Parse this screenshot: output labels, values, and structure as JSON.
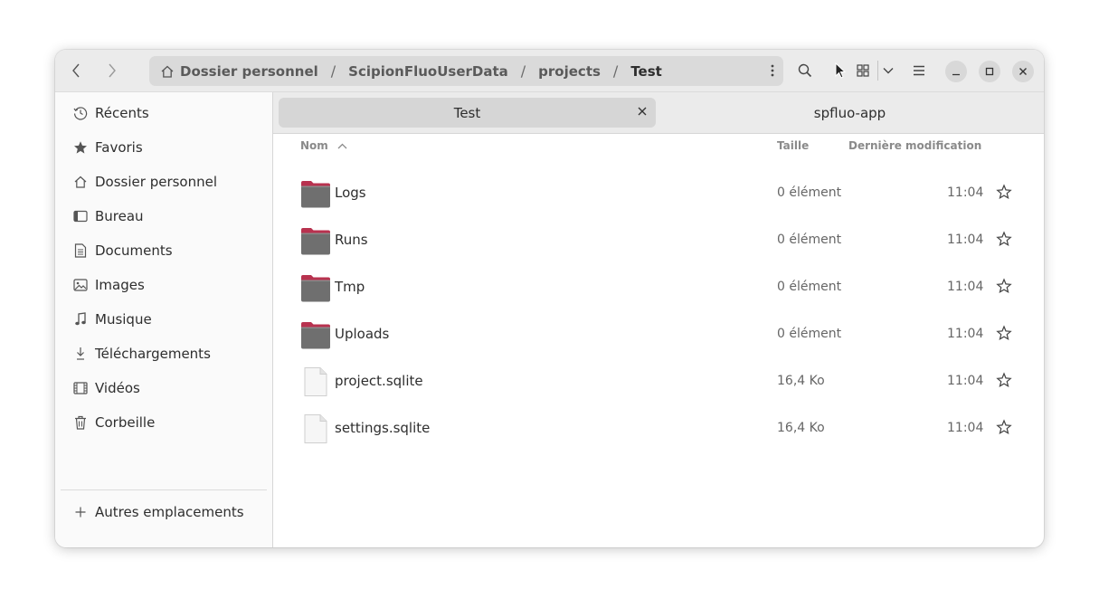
{
  "pathbar": {
    "crumbs": [
      "Dossier personnel",
      "ScipionFluoUserData",
      "projects",
      "Test"
    ],
    "separator": "/"
  },
  "sidebar": {
    "items": [
      {
        "label": "Récents",
        "icon": "clock-icon"
      },
      {
        "label": "Favoris",
        "icon": "star-icon"
      },
      {
        "label": "Dossier personnel",
        "icon": "home-icon"
      },
      {
        "label": "Bureau",
        "icon": "desktop-icon"
      },
      {
        "label": "Documents",
        "icon": "document-icon"
      },
      {
        "label": "Images",
        "icon": "image-icon"
      },
      {
        "label": "Musique",
        "icon": "music-icon"
      },
      {
        "label": "Téléchargements",
        "icon": "download-icon"
      },
      {
        "label": "Vidéos",
        "icon": "film-icon"
      },
      {
        "label": "Corbeille",
        "icon": "trash-icon"
      }
    ],
    "other_locations": "Autres emplacements"
  },
  "tabs": [
    {
      "label": "Test",
      "active": true
    },
    {
      "label": "spfluo-app",
      "active": false
    }
  ],
  "columns": {
    "name": "Nom",
    "size": "Taille",
    "modified": "Dernière modification"
  },
  "files": [
    {
      "name": "Logs",
      "kind": "folder",
      "size": "0 élément",
      "modified": "11:04"
    },
    {
      "name": "Runs",
      "kind": "folder",
      "size": "0 élément",
      "modified": "11:04"
    },
    {
      "name": "Tmp",
      "kind": "folder",
      "size": "0 élément",
      "modified": "11:04"
    },
    {
      "name": "Uploads",
      "kind": "folder",
      "size": "0 élément",
      "modified": "11:04"
    },
    {
      "name": "project.sqlite",
      "kind": "file",
      "size": "16,4 Ko",
      "modified": "11:04"
    },
    {
      "name": "settings.sqlite",
      "kind": "file",
      "size": "16,4 Ko",
      "modified": "11:04"
    }
  ],
  "colors": {
    "folder_tab": "#b8324f",
    "folder_body": "#6f6f6f",
    "headerbar": "#ebebeb"
  }
}
